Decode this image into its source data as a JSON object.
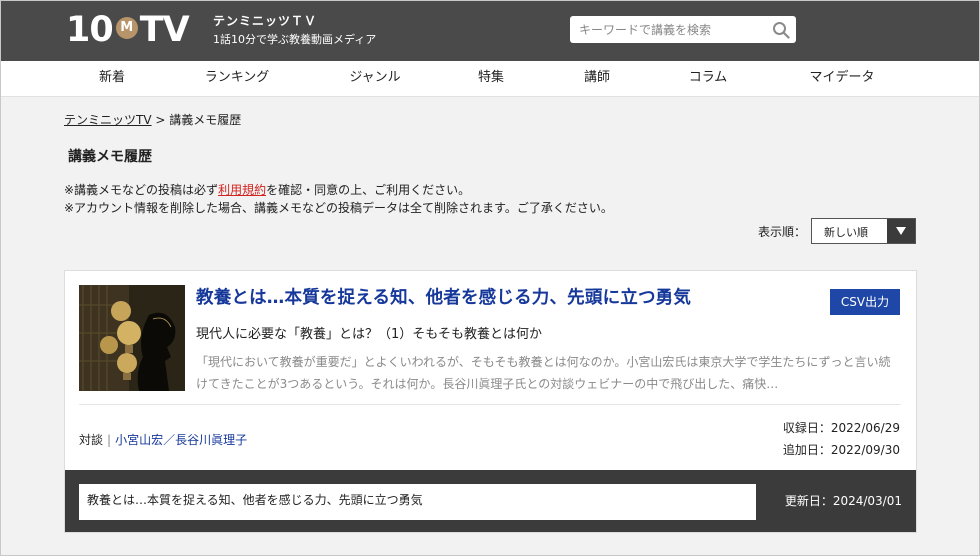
{
  "header": {
    "logo_left": "10",
    "logo_mid": "M",
    "logo_right": "TV",
    "site_name": "テンミニッツＴＶ",
    "tagline": "1話10分で学ぶ教養動画メディア",
    "search_placeholder": "キーワードで講義を検索"
  },
  "nav": {
    "items": [
      "新着",
      "ランキング",
      "ジャンル",
      "特集",
      "講師",
      "コラム",
      "マイデータ"
    ]
  },
  "breadcrumb": {
    "home": "テンミニッツTV",
    "separator": " > ",
    "current": "講義メモ履歴"
  },
  "page": {
    "title": "講義メモ履歴",
    "notice1_pre": "※講義メモなどの投稿は必ず",
    "notice1_link": "利用規約",
    "notice1_post": "を確認・同意の上、ご利用ください。",
    "notice2": "※アカウント情報を削除した場合、講義メモなどの投稿データは全て削除されます。ご了承ください。",
    "sort_label": "表示順：",
    "sort_value": "新しい順"
  },
  "card": {
    "title": "教養とは…本質を捉える知、他者を感じる力、先頭に立つ勇気",
    "csv_label": "CSV出力",
    "subtitle": "現代人に必要な「教養」とは？（1）そもそも教養とは何か",
    "description": "「現代において教養が重要だ」とよくいわれるが、そもそも教養とは何なのか。小宮山宏氏は東京大学で学生たちにずっと言い続けてきたことが3つあるという。それは何か。長谷川眞理子氏との対談ウェビナーの中で飛び出した、痛快…",
    "category": "対談",
    "separator": "|",
    "speakers": "小宮山宏／長谷川眞理子",
    "recorded_label": "収録日：",
    "recorded_date": "2022/06/29",
    "added_label": "追加日：",
    "added_date": "2022/09/30",
    "memo_text": "教養とは…本質を捉える知、他者を感じる力、先頭に立つ勇気",
    "updated_label": "更新日：",
    "updated_date": "2024/03/01"
  },
  "colors": {
    "header_bg": "#4a4a4a",
    "title_blue": "#16389a",
    "csv_button": "#1e47a8",
    "link_red": "#d1241f",
    "memo_bar": "#3b3b3b"
  }
}
